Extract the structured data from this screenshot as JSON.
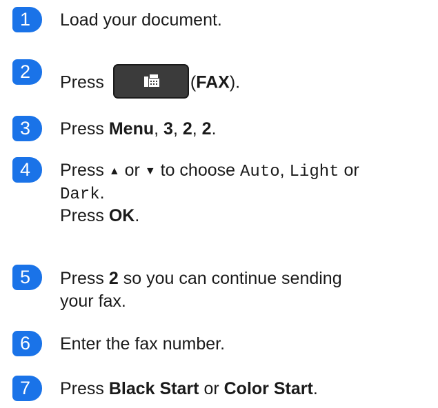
{
  "steps": [
    {
      "number": "1",
      "text": "Load your document."
    },
    {
      "number": "2",
      "press": "Press",
      "open_paren": "(",
      "fax_label": "FAX",
      "close_paren": ").",
      "icon": "fax-icon"
    },
    {
      "number": "3",
      "press": "Press",
      "menu": "Menu",
      "sep1": ", ",
      "k1": "3",
      "sep2": ", ",
      "k2": "2",
      "sep3": ", ",
      "k3": "2",
      "end": "."
    },
    {
      "number": "4",
      "press": "Press",
      "up_arrow": "▲",
      "or1": "or",
      "down_arrow": "▼",
      "to_choose": "to choose",
      "opt_auto": "Auto",
      "comma": ",",
      "opt_light": "Light",
      "or2": "or",
      "opt_dark": "Dark",
      "period": ".",
      "press2": "Press",
      "ok": "OK",
      "period2": "."
    },
    {
      "number": "5",
      "press": "Press",
      "key": "2",
      "rest_line1": "so you can continue sending",
      "rest_line2": "your fax."
    },
    {
      "number": "6",
      "text": "Enter the fax number."
    },
    {
      "number": "7",
      "press": "Press",
      "black_start": "Black Start",
      "or": "or",
      "color_start": "Color Start",
      "end": "."
    }
  ],
  "colors": {
    "badge": "#1a73e8",
    "button": "#3b3b3b"
  }
}
